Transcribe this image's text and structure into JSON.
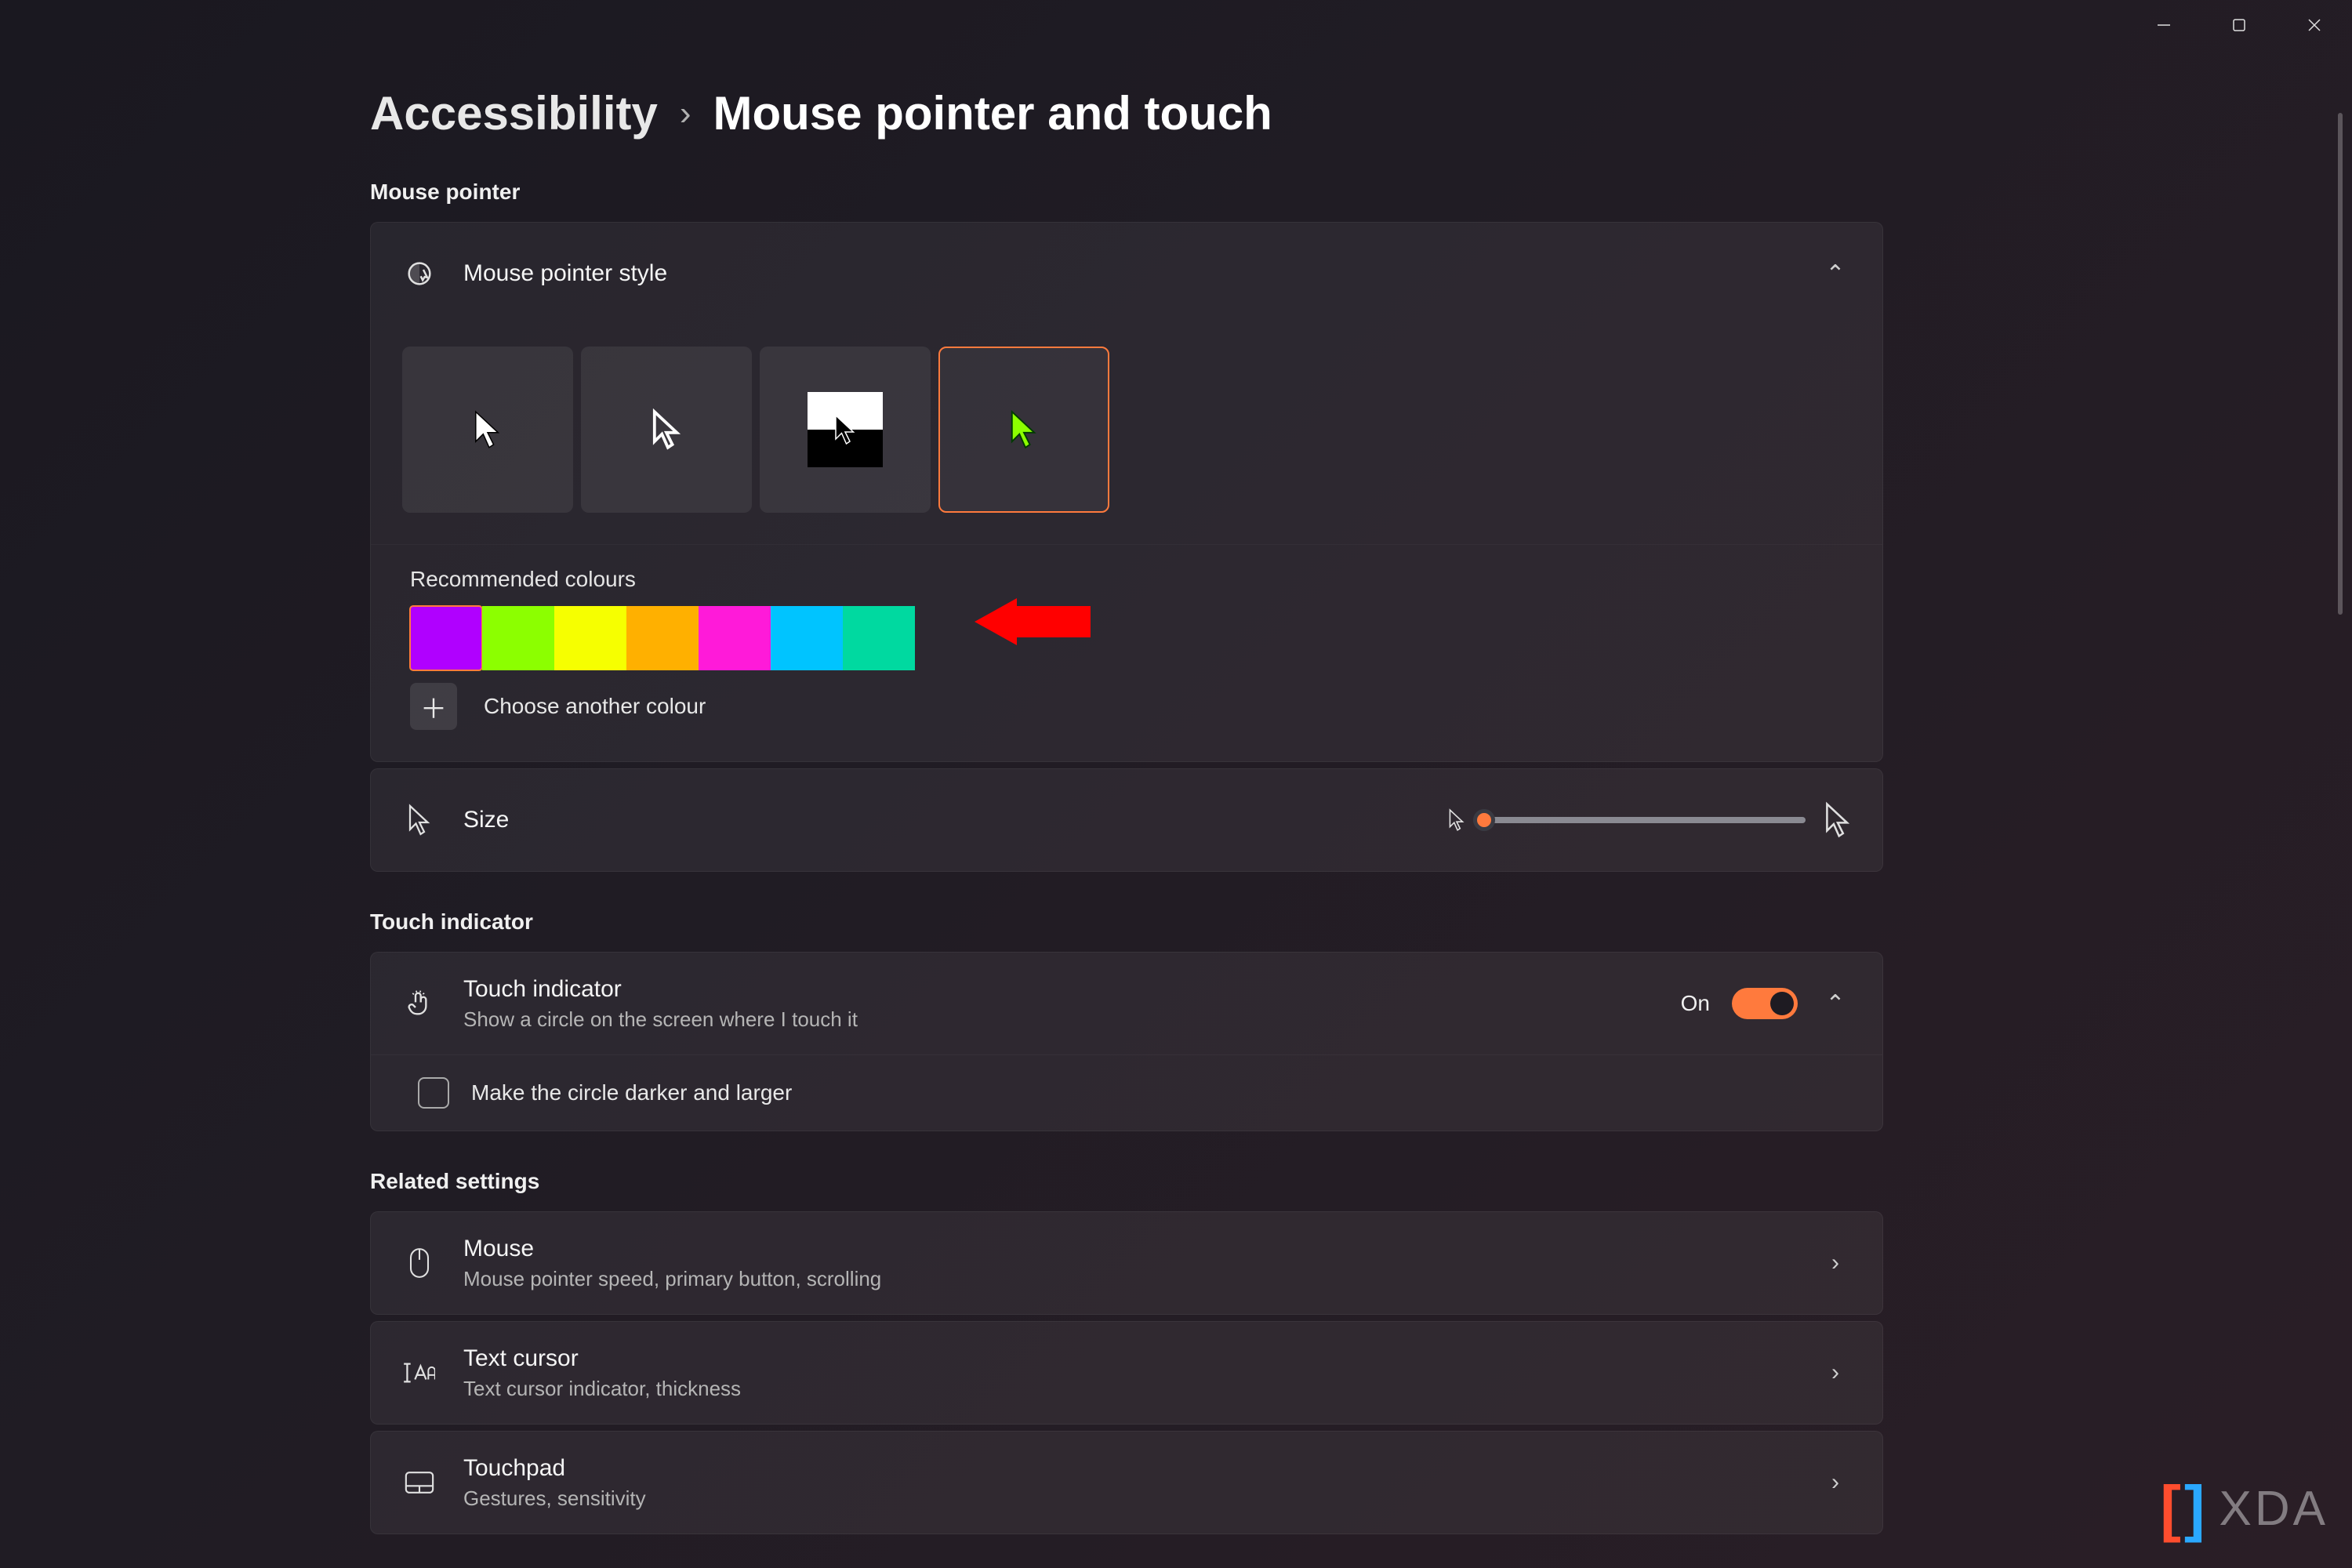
{
  "breadcrumb": {
    "parent": "Accessibility",
    "current": "Mouse pointer and touch"
  },
  "sections": {
    "mouse_pointer": "Mouse pointer",
    "touch_indicator": "Touch indicator",
    "related": "Related settings"
  },
  "pointer_style": {
    "label": "Mouse pointer style",
    "options": [
      {
        "id": "white"
      },
      {
        "id": "black"
      },
      {
        "id": "inverted"
      },
      {
        "id": "custom"
      }
    ],
    "selected": "custom"
  },
  "colours": {
    "label": "Recommended colours",
    "swatches": [
      "#b000ff",
      "#8cff00",
      "#f6ff00",
      "#ffb000",
      "#ff1ad9",
      "#00c4ff",
      "#00d9a0"
    ],
    "selected_index": 0,
    "choose_label": "Choose another colour"
  },
  "size": {
    "label": "Size"
  },
  "touch": {
    "title": "Touch indicator",
    "sub": "Show a circle on the screen where I touch it",
    "state_label": "On",
    "checkbox_label": "Make the circle darker and larger"
  },
  "related": {
    "mouse": {
      "title": "Mouse",
      "sub": "Mouse pointer speed, primary button, scrolling"
    },
    "text_cursor": {
      "title": "Text cursor",
      "sub": "Text cursor indicator, thickness"
    },
    "touchpad": {
      "title": "Touchpad",
      "sub": "Gestures, sensitivity"
    }
  },
  "logo": "XDA",
  "accent": "#ff7a3d",
  "custom_cursor_colour": "#8cff00"
}
